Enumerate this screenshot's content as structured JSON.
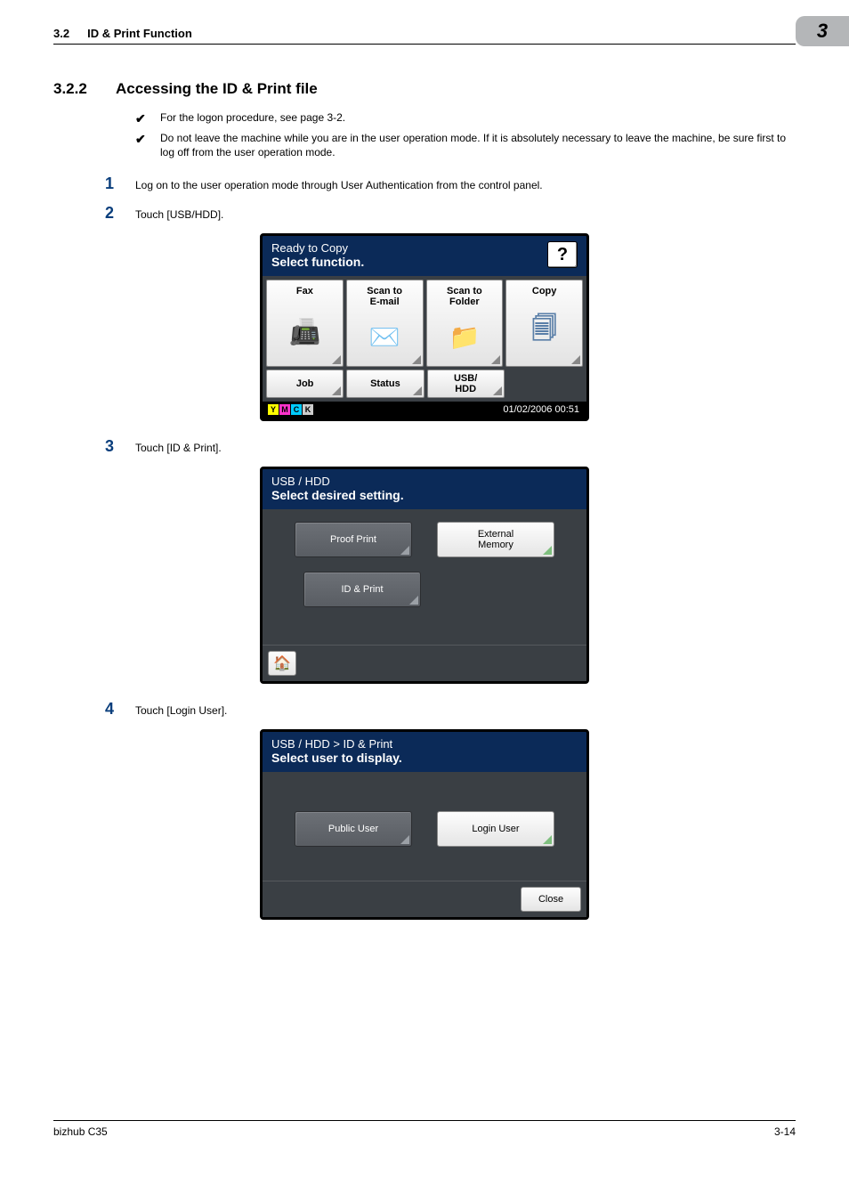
{
  "header": {
    "section_num": "3.2",
    "section_title": "ID & Print Function",
    "chapter": "3"
  },
  "heading": {
    "num": "3.2.2",
    "title": "Accessing the ID & Print file"
  },
  "bullets": [
    "For the logon procedure, see page 3-2.",
    "Do not leave the machine while you are in the user operation mode. If it is absolutely necessary to leave the machine, be sure first to log off from the user operation mode."
  ],
  "steps": [
    {
      "n": "1",
      "text": "Log on to the user operation mode through User Authentication from the control panel."
    },
    {
      "n": "2",
      "text": "Touch [USB/HDD]."
    },
    {
      "n": "3",
      "text": "Touch [ID & Print]."
    },
    {
      "n": "4",
      "text": "Touch [Login User]."
    }
  ],
  "panel1": {
    "title1": "Ready to Copy",
    "title2": "Select function.",
    "tiles": [
      "Fax",
      "Scan to\nE-mail",
      "Scan to\nFolder",
      "Copy"
    ],
    "mini": [
      "Job",
      "Status",
      "USB/\nHDD"
    ],
    "ymck": [
      "Y",
      "M",
      "C",
      "K"
    ],
    "timestamp": "01/02/2006  00:51"
  },
  "panel2": {
    "breadcrumb": "USB / HDD",
    "title2": "Select desired setting.",
    "buttons_row1": [
      "Proof Print",
      "External\nMemory"
    ],
    "buttons_row2": [
      "ID & Print"
    ]
  },
  "panel3": {
    "breadcrumb": "USB / HDD > ID & Print",
    "title2": "Select user to display.",
    "buttons": [
      "Public User",
      "Login User"
    ],
    "close": "Close"
  },
  "footer": {
    "left": "bizhub C35",
    "right": "3-14"
  }
}
